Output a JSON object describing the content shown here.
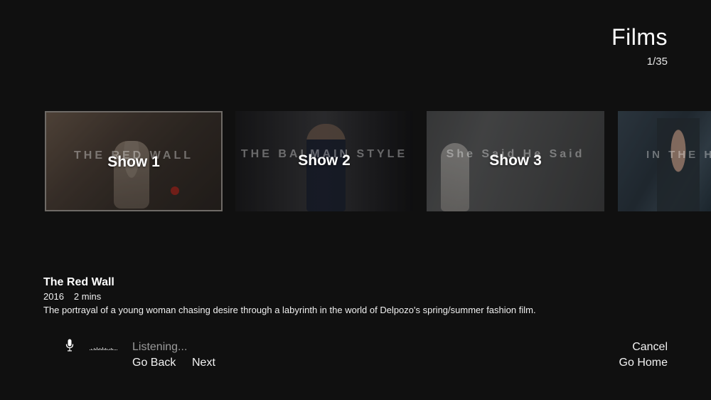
{
  "header": {
    "title": "Films",
    "count": "1/35"
  },
  "carousel": {
    "tiles": [
      {
        "caption": "Show 1",
        "background_text": "THE RED WALL"
      },
      {
        "caption": "Show 2",
        "background_text": "THE BALMAIN STYLE"
      },
      {
        "caption": "Show 3",
        "background_text": "She Said He Said"
      },
      {
        "caption": "",
        "background_text": "IN THE HOUR OF MAYA"
      }
    ]
  },
  "details": {
    "title": "The Red Wall",
    "year": "2016",
    "duration": "2 mins",
    "description": "The portrayal of a young woman chasing desire through a labyrinth in the world of Delpozo's spring/summer fashion film."
  },
  "voice": {
    "icon": "microphone-icon",
    "status": "Listening...",
    "commands": {
      "back": "Go Back",
      "next": "Next",
      "cancel": "Cancel",
      "home": "Go Home"
    }
  }
}
